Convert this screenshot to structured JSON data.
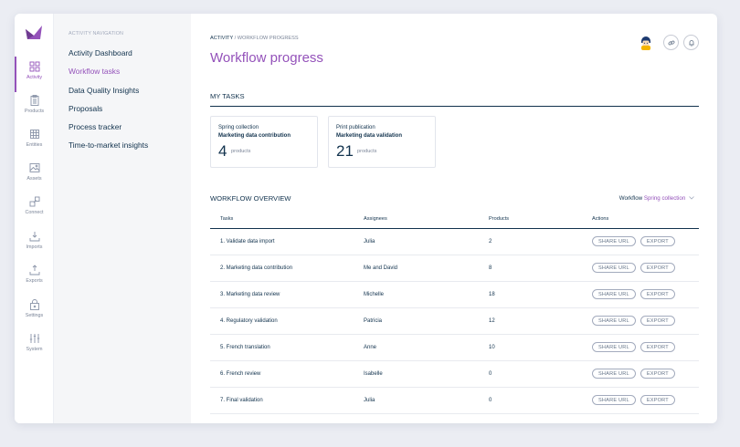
{
  "rail": {
    "items": [
      {
        "key": "activity",
        "label": "Activity",
        "icon": "grid-icon",
        "active": true
      },
      {
        "key": "products",
        "label": "Products",
        "icon": "clipboard-icon",
        "active": false
      },
      {
        "key": "entities",
        "label": "Entities",
        "icon": "entities-icon",
        "active": false
      },
      {
        "key": "assets",
        "label": "Assets",
        "icon": "image-icon",
        "active": false
      },
      {
        "key": "connect",
        "label": "Connect",
        "icon": "connect-icon",
        "active": false
      },
      {
        "key": "imports",
        "label": "Imports",
        "icon": "import-icon",
        "active": false
      },
      {
        "key": "exports",
        "label": "Exports",
        "icon": "export-icon",
        "active": false
      },
      {
        "key": "settings",
        "label": "Settings",
        "icon": "lock-icon",
        "active": false
      },
      {
        "key": "system",
        "label": "System",
        "icon": "sliders-icon",
        "active": false
      }
    ]
  },
  "subnav": {
    "title": "ACTIVITY NAVIGATION",
    "items": [
      {
        "label": "Activity Dashboard",
        "active": false
      },
      {
        "label": "Workflow tasks",
        "active": true
      },
      {
        "label": "Data Quality Insights",
        "active": false
      },
      {
        "label": "Proposals",
        "active": false
      },
      {
        "label": "Process tracker",
        "active": false
      },
      {
        "label": "Time-to-market insights",
        "active": false
      }
    ]
  },
  "header": {
    "breadcrumb_root": "ACTIVITY",
    "breadcrumb_sep": "/",
    "breadcrumb_current": "WORKFLOW PROGRESS",
    "title": "Workflow progress"
  },
  "my_tasks": {
    "title": "MY TASKS",
    "cards": [
      {
        "workflow": "Spring collection",
        "step": "Marketing data contribution",
        "count": "4",
        "unit": "products"
      },
      {
        "workflow": "Print publication",
        "step": "Marketing data validation",
        "count": "21",
        "unit": "products"
      }
    ]
  },
  "overview": {
    "title": "WORKFLOW OVERVIEW",
    "filter_label": "Workflow",
    "filter_value": "Spring collection",
    "columns": [
      "Tasks",
      "Assignees",
      "Products",
      "Actions"
    ],
    "share_label": "SHARE URL",
    "export_label": "EXPORT",
    "rows": [
      {
        "task": "1. Validate data import",
        "assignee": "Julia",
        "products": "2"
      },
      {
        "task": "2. Marketing data contribution",
        "assignee": "Me and David",
        "products": "8"
      },
      {
        "task": "3. Marketing data review",
        "assignee": "Michelle",
        "products": "18"
      },
      {
        "task": "4. Regulatory validation",
        "assignee": "Patricia",
        "products": "12"
      },
      {
        "task": "5. French translation",
        "assignee": "Anne",
        "products": "10"
      },
      {
        "task": "6. French review",
        "assignee": "Isabelle",
        "products": "0"
      },
      {
        "task": "7. Final validation",
        "assignee": "Julia",
        "products": "0"
      }
    ]
  },
  "colors": {
    "accent": "#9452ba",
    "text": "#11324d",
    "muted": "#7b8598",
    "background": "#ebedf3"
  }
}
